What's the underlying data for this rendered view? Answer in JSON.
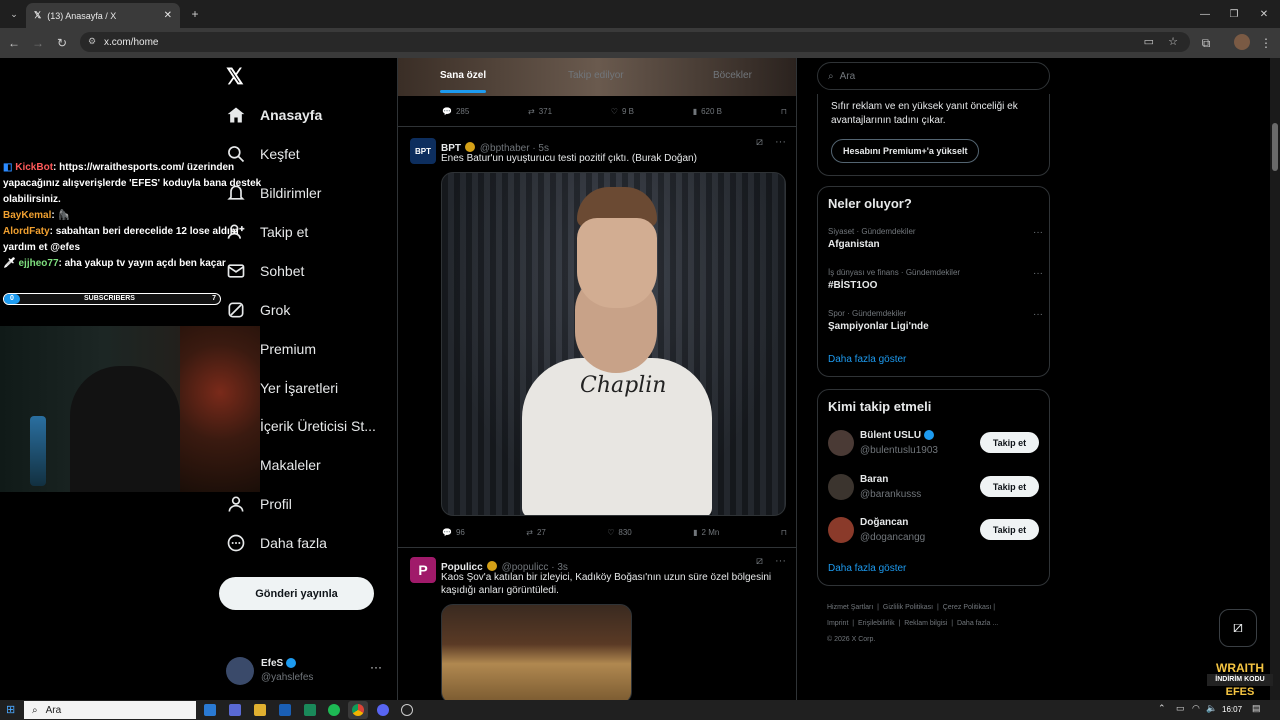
{
  "browser": {
    "tab_title": "(13) Anasayfa / X",
    "url": "x.com/home"
  },
  "sidebar": {
    "items": [
      {
        "label": "Anasayfa"
      },
      {
        "label": "Keşfet"
      },
      {
        "label": "Bildirimler"
      },
      {
        "label": "Takip et"
      },
      {
        "label": "Sohbet"
      },
      {
        "label": "Grok"
      },
      {
        "label": "Premium"
      },
      {
        "label": "Yer İşaretleri"
      },
      {
        "label": "İçerik Üreticisi St..."
      },
      {
        "label": "Makaleler"
      },
      {
        "label": "Profil"
      },
      {
        "label": "Daha fazla"
      }
    ],
    "post_button": "Gönderi yayınla",
    "account": {
      "name": "EfeS",
      "handle": "@yahslefes",
      "more": "···"
    }
  },
  "feed": {
    "tabs": [
      "Sana özel",
      "Takip edilyor",
      "Böcekler"
    ],
    "top_actions": {
      "replies": "285",
      "reposts": "371",
      "likes": "9 B",
      "views": "620 B"
    },
    "posts": [
      {
        "name": "BPT",
        "handle": "@bpthaber · 5s",
        "avatar": "BPT",
        "text": "Enes Batur'un uyuşturucu testi pozitif çıktı. (Burak Doğan)",
        "shirt_text": "Chaplin",
        "actions": {
          "replies": "96",
          "reposts": "27",
          "likes": "830",
          "views": "2 Mn"
        }
      },
      {
        "name": "Populicc",
        "handle": "@populicc · 3s",
        "avatar": "P",
        "text": "Kaos Şov'a katılan bir izleyici, Kadıköy Boğası'nın uzun süre özel bölgesini kaşıdığı anları görüntüledi."
      }
    ]
  },
  "right": {
    "search_placeholder": "Ara",
    "premium": {
      "text": "Sıfır reklam ve en yüksek yanıt önceliği ek avantajlarının tadını çıkar.",
      "button": "Hesabını Premium+'a yükselt"
    },
    "trends": {
      "title": "Neler oluyor?",
      "items": [
        {
          "category": "Siyaset · Gündemdekiler",
          "name": "Afganistan"
        },
        {
          "category": "İş dünyası ve finans · Gündemdekiler",
          "name": "#BİST1OO"
        },
        {
          "category": "Spor · Gündemdekiler",
          "name": "Şampiyonlar Ligi'nde"
        }
      ],
      "more": "Daha fazla göster"
    },
    "who_to_follow": {
      "title": "Kimi takip etmeli",
      "items": [
        {
          "name": "Bülent USLU",
          "handle": "@bulentuslu1903",
          "button": "Takip et"
        },
        {
          "name": "Baran",
          "handle": "@barankusss",
          "button": "Takip et"
        },
        {
          "name": "Doğancan",
          "handle": "@dogancangg",
          "button": "Takip et"
        }
      ],
      "more": "Daha fazla göster"
    },
    "footer": {
      "line1": [
        "Hizmet Şartları",
        "Gizlilik Politikası",
        "Çerez Politikası"
      ],
      "line2": [
        "Imprint",
        "Erişilebilirlik",
        "Reklam bilgisi",
        "Daha fazla ..."
      ],
      "copyright": "© 2026 X Corp."
    }
  },
  "overlay": {
    "chat": [
      {
        "user": "KickBot",
        "text": ": https://wraithesports.com/ üzerinden yapacağınız alışverişlerde 'EFES' koduyla bana destek olabilirsiniz.",
        "color": "#ff5a5a"
      },
      {
        "user": "BayKemal",
        "text": ": 🦍",
        "color": "#f0a030"
      },
      {
        "user": "AlordFaty",
        "text": ": sabahtan beri derecelide 12 lose aldım yardım et @efes",
        "color": "#f0a030"
      },
      {
        "user": "ejjheo77",
        "text": ": aha yakup tv yayın açdı ben kaçar",
        "color": "#7fe07f"
      }
    ],
    "subscribers": {
      "label": "SUBSCRIBERS",
      "current": "0",
      "goal": "7"
    },
    "sponsor": {
      "line1": "WRAITH",
      "line2": "İNDİRİM KODU",
      "line3": "EFES"
    }
  },
  "taskbar": {
    "search": "Ara",
    "time": "16:07"
  }
}
